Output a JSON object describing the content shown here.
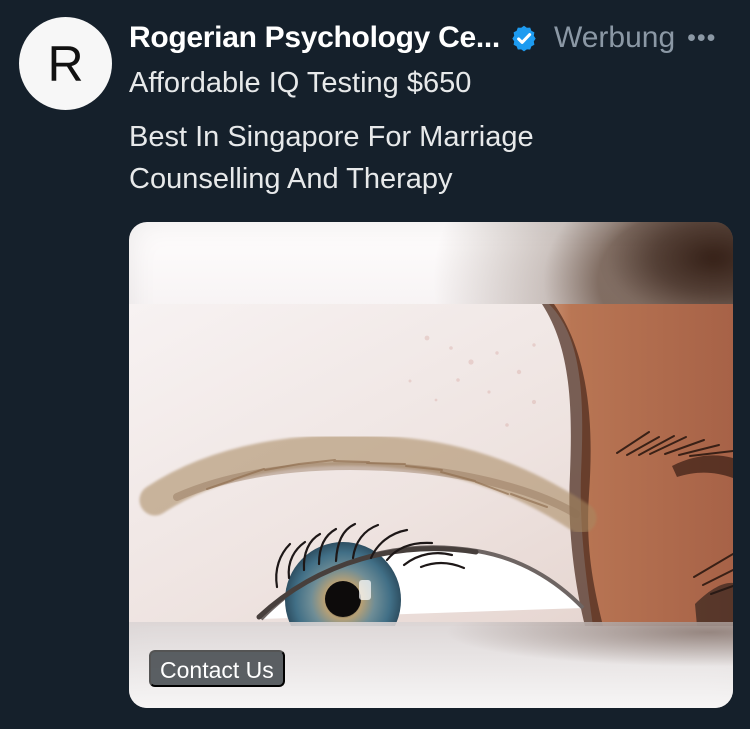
{
  "account": {
    "avatar_letter": "R",
    "name": "Rogerian Psychology Ce...",
    "verified_icon": "verified-badge-icon",
    "ad_label": "Werbung",
    "more_icon": "more-dots-icon",
    "more_symbol": "•••"
  },
  "post": {
    "line_1": "Affordable IQ Testing $650",
    "line_2": "Best In Singapore For Marriage",
    "line_3": "Counselling And Therapy"
  },
  "media": {
    "type": "close-up photo of two eyes",
    "cta_label": "Contact Us"
  },
  "colors": {
    "background": "#15202b",
    "primary_text": "#e7e9ea",
    "secondary_text": "#8b98a5",
    "verified_blue": "#1d9bf0",
    "cta_background": "#464b50"
  }
}
